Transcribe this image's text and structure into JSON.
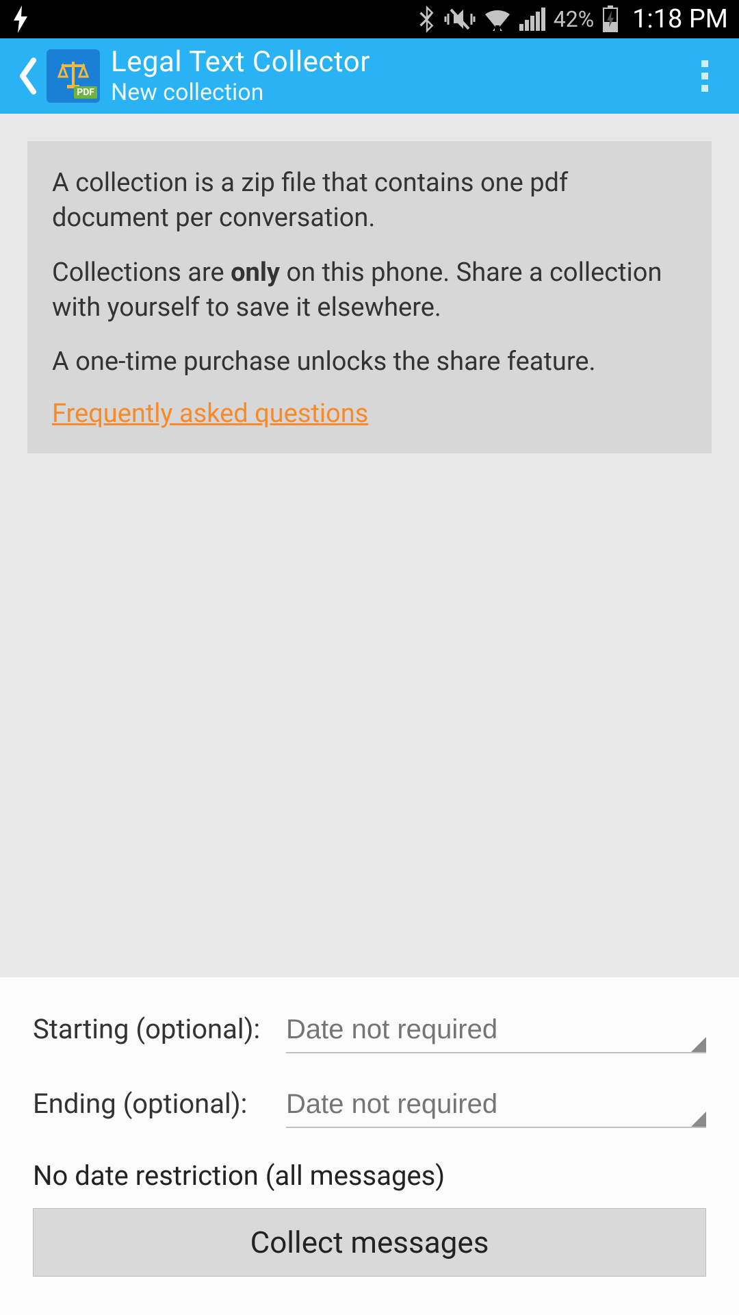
{
  "status": {
    "battery_pct": "42%",
    "time": "1:18 PM"
  },
  "appbar": {
    "title": "Legal Text Collector",
    "subtitle": "New collection",
    "pdf_badge": "PDF"
  },
  "info": {
    "p1": "A collection is a zip file that contains one pdf document per conversation.",
    "p2a": "Collections are ",
    "p2b": "only",
    "p2c": " on this phone. Share a collection with yourself to save it elsewhere.",
    "p3": "A one-time purchase unlocks the share feature.",
    "faq": "Frequently asked questions"
  },
  "form": {
    "start_label": "Starting (optional):",
    "start_placeholder": "Date not required",
    "end_label": "Ending (optional):",
    "end_placeholder": "Date not required",
    "restriction_text": "No date restriction (all messages)",
    "collect_label": "Collect messages"
  }
}
